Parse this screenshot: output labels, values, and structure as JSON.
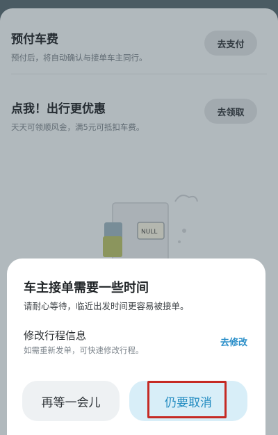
{
  "cards": [
    {
      "title": "预付车费",
      "subtitle": "预付后，将自动确认与接单车主同行。",
      "button": "去支付"
    },
    {
      "title": "点我！出行更优惠",
      "subtitle": "天天可领顺风金，满5元可抵扣车费。",
      "button": "去领取"
    }
  ],
  "illustration": {
    "tag_text": "NULL"
  },
  "sheet": {
    "title": "车主接单需要一些时间",
    "subtitle": "请耐心等待，临近出发时间更容易被接单。",
    "section_title": "修改行程信息",
    "section_subtitle": "如需重新发单，可快速修改行程。",
    "modify_link": "去修改",
    "wait_button": "再等一会儿",
    "cancel_button": "仍要取消"
  },
  "colors": {
    "accent": "#2b8fc9",
    "highlight": "#c52a24"
  }
}
